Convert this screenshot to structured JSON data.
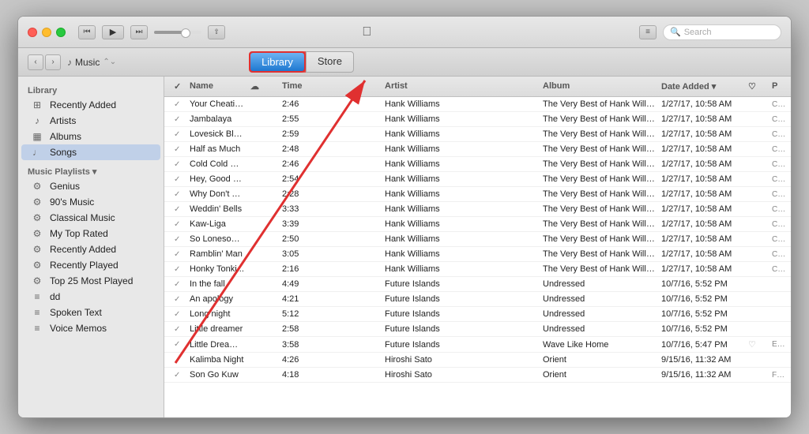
{
  "titlebar": {
    "rewind_label": "⏮",
    "play_label": "▶",
    "forward_label": "⏭",
    "airplay_label": "⇧",
    "apple_logo": "",
    "menu_label": "≡",
    "search_placeholder": "Search"
  },
  "navbar": {
    "back_label": "‹",
    "forward_label": "›",
    "location": "Music",
    "tab_library": "Library",
    "tab_store": "Store"
  },
  "sidebar": {
    "library_label": "Library",
    "items": [
      {
        "id": "recently-added",
        "icon": "⊞",
        "label": "Recently Added"
      },
      {
        "id": "artists",
        "icon": "♪",
        "label": "Artists"
      },
      {
        "id": "albums",
        "icon": "▦",
        "label": "Albums"
      },
      {
        "id": "songs",
        "icon": "♩",
        "label": "Songs"
      }
    ],
    "playlists_label": "Music Playlists ▾",
    "playlists": [
      {
        "id": "genius",
        "icon": "⚙",
        "label": "Genius"
      },
      {
        "id": "90s-music",
        "icon": "⚙",
        "label": "90's Music"
      },
      {
        "id": "classical",
        "icon": "⚙",
        "label": "Classical Music"
      },
      {
        "id": "top-rated",
        "icon": "⚙",
        "label": "My Top Rated"
      },
      {
        "id": "recently-added-pl",
        "icon": "⚙",
        "label": "Recently Added"
      },
      {
        "id": "recently-played",
        "icon": "⚙",
        "label": "Recently Played"
      },
      {
        "id": "top25",
        "icon": "⚙",
        "label": "Top 25 Most Played"
      },
      {
        "id": "dd",
        "icon": "≡",
        "label": "dd"
      },
      {
        "id": "spoken-text",
        "icon": "≡",
        "label": "Spoken Text"
      },
      {
        "id": "voice-memos",
        "icon": "≡",
        "label": "Voice Memos"
      }
    ]
  },
  "table": {
    "headers": [
      "✓",
      "Name",
      "☁",
      "Time",
      "Artist",
      "Album",
      "Date Added",
      "♡",
      "P"
    ],
    "rows": [
      {
        "check": "✓",
        "name": "Your Cheatin' Heart",
        "cloud": "",
        "time": "2:46",
        "artist": "Hank Williams",
        "album": "The Very Best of Hank Williams",
        "date": "1/27/17, 10:58 AM",
        "genre": "Country W...",
        "heart": "",
        "playing": false
      },
      {
        "check": "✓",
        "name": "Jambalaya",
        "cloud": "",
        "time": "2:55",
        "artist": "Hank Williams",
        "album": "The Very Best of Hank Williams",
        "date": "1/27/17, 10:58 AM",
        "genre": "Country W...",
        "heart": "",
        "playing": false
      },
      {
        "check": "✓",
        "name": "Lovesick Blues",
        "cloud": "",
        "time": "2:59",
        "artist": "Hank Williams",
        "album": "The Very Best of Hank Williams",
        "date": "1/27/17, 10:58 AM",
        "genre": "Country W...",
        "heart": "",
        "playing": false
      },
      {
        "check": "✓",
        "name": "Half as Much",
        "cloud": "",
        "time": "2:48",
        "artist": "Hank Williams",
        "album": "The Very Best of Hank Williams",
        "date": "1/27/17, 10:58 AM",
        "genre": "Country W...",
        "heart": "",
        "playing": false
      },
      {
        "check": "✓",
        "name": "Cold Cold Heart",
        "cloud": "",
        "time": "2:46",
        "artist": "Hank Williams",
        "album": "The Very Best of Hank Williams",
        "date": "1/27/17, 10:58 AM",
        "genre": "Country W...",
        "heart": "",
        "playing": false
      },
      {
        "check": "✓",
        "name": "Hey, Good Lookin'",
        "cloud": "",
        "time": "2:54",
        "artist": "Hank Williams",
        "album": "The Very Best of Hank Williams",
        "date": "1/27/17, 10:58 AM",
        "genre": "Country W...",
        "heart": "",
        "playing": false
      },
      {
        "check": "✓",
        "name": "Why Don't You Love Me",
        "cloud": "",
        "time": "2:28",
        "artist": "Hank Williams",
        "album": "The Very Best of Hank Williams",
        "date": "1/27/17, 10:58 AM",
        "genre": "Country W...",
        "heart": "",
        "playing": false
      },
      {
        "check": "✓",
        "name": "Weddin' Bells",
        "cloud": "",
        "time": "3:33",
        "artist": "Hank Williams",
        "album": "The Very Best of Hank Williams",
        "date": "1/27/17, 10:58 AM",
        "genre": "Country W...",
        "heart": "",
        "playing": false
      },
      {
        "check": "✓",
        "name": "Kaw-Liga",
        "cloud": "",
        "time": "3:39",
        "artist": "Hank Williams",
        "album": "The Very Best of Hank Williams",
        "date": "1/27/17, 10:58 AM",
        "genre": "Country W...",
        "heart": "",
        "playing": false
      },
      {
        "check": "✓",
        "name": "So Lonesome I Could Cry",
        "cloud": "",
        "time": "2:50",
        "artist": "Hank Williams",
        "album": "The Very Best of Hank Williams",
        "date": "1/27/17, 10:58 AM",
        "genre": "Country W...",
        "heart": "",
        "playing": false
      },
      {
        "check": "✓",
        "name": "Ramblin' Man",
        "cloud": "",
        "time": "3:05",
        "artist": "Hank Williams",
        "album": "The Very Best of Hank Williams",
        "date": "1/27/17, 10:58 AM",
        "genre": "Country W...",
        "heart": "",
        "playing": false
      },
      {
        "check": "✓",
        "name": "Honky Tonki...",
        "cloud": "",
        "time": "2:16",
        "artist": "Hank Williams",
        "album": "The Very Best of Hank Williams",
        "date": "1/27/17, 10:58 AM",
        "genre": "Country W...",
        "heart": "",
        "playing": false
      },
      {
        "check": "✓",
        "name": "In the fall",
        "cloud": "",
        "time": "4:49",
        "artist": "Future Islands",
        "album": "Undressed",
        "date": "10/7/16, 5:52 PM",
        "genre": "",
        "heart": "",
        "playing": false
      },
      {
        "check": "✓",
        "name": "An apology",
        "cloud": "",
        "time": "4:21",
        "artist": "Future Islands",
        "album": "Undressed",
        "date": "10/7/16, 5:52 PM",
        "genre": "",
        "heart": "",
        "playing": false
      },
      {
        "check": "✓",
        "name": "Long night",
        "cloud": "",
        "time": "5:12",
        "artist": "Future Islands",
        "album": "Undressed",
        "date": "10/7/16, 5:52 PM",
        "genre": "",
        "heart": "",
        "playing": false
      },
      {
        "check": "✓",
        "name": "Little dreamer",
        "cloud": "",
        "time": "2:58",
        "artist": "Future Islands",
        "album": "Undressed",
        "date": "10/7/16, 5:52 PM",
        "genre": "",
        "heart": "",
        "playing": false
      },
      {
        "check": "✓",
        "name": "Little Dreamer ···",
        "cloud": "",
        "time": "3:58",
        "artist": "Future Islands",
        "album": "Wave Like Home",
        "date": "10/7/16, 5:47 PM",
        "genre": "Electronic",
        "heart": "♡",
        "playing": false
      },
      {
        "check": "",
        "name": "Kalimba Night",
        "cloud": "",
        "time": "4:26",
        "artist": "Hiroshi Sato",
        "album": "Orient",
        "date": "9/15/16, 11:32 AM",
        "genre": "",
        "heart": "",
        "playing": false
      },
      {
        "check": "✓",
        "name": "Son Go Kuw",
        "cloud": "",
        "time": "4:18",
        "artist": "Hiroshi Sato",
        "album": "Orient",
        "date": "9/15/16, 11:32 AM",
        "genre": "Funk",
        "heart": "",
        "playing": false
      }
    ]
  }
}
